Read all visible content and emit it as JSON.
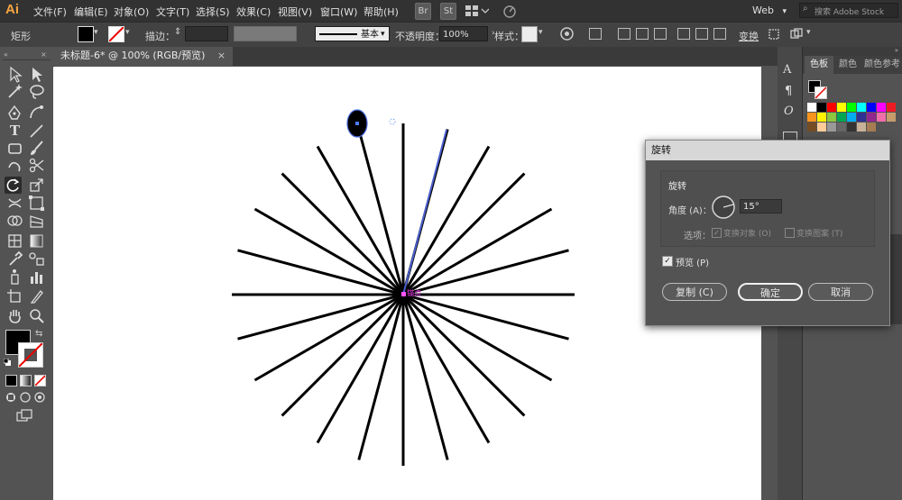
{
  "app": {
    "logo": "Ai"
  },
  "menubar": {
    "items": [
      "文件(F)",
      "编辑(E)",
      "对象(O)",
      "文字(T)",
      "选择(S)",
      "效果(C)",
      "视图(V)",
      "窗口(W)",
      "帮助(H)"
    ],
    "bridge": "Br",
    "stock": "St",
    "workspace": "Web",
    "search_placeholder": "搜索 Adobe Stock"
  },
  "control": {
    "object_label": "矩形",
    "stroke_label": "描边：",
    "stroke_style": "基本",
    "opacity_label": "不透明度：",
    "opacity_value": "100%",
    "style_label": "样式：",
    "transform_label": "变换"
  },
  "document": {
    "tab_title": "未标题-6* @ 100% (RGB/预览)",
    "anchor_label": "锚点"
  },
  "panels": {
    "tabs": [
      "色板",
      "颜色",
      "颜色参考"
    ]
  },
  "dialog": {
    "title": "旋转",
    "section": "旋转",
    "angle_label": "角度 (A)：",
    "angle_value": "15°",
    "options_label": "选项：",
    "transform_objects": "变换对象 (O)",
    "transform_patterns": "变换图案 (T)",
    "preview": "预览 (P)",
    "copy_button": "复制 (C)",
    "ok_button": "确定",
    "cancel_button": "取消"
  },
  "colors": {
    "accent": "#f7a440",
    "swatches": [
      "#ffffff",
      "#000000",
      "#ff0000",
      "#ffff00",
      "#00ff00",
      "#00ffff",
      "#0000ff",
      "#ff00ff",
      "#ed1c24",
      "#f7941d",
      "#fff200",
      "#8dc63f",
      "#00a651",
      "#00aeef",
      "#2e3192",
      "#92278f",
      "#f06eaa",
      "#c69c6d",
      "#754c24",
      "#ffcc99",
      "#999999",
      "#666666",
      "#333333",
      "#c7b299",
      "#a67c52"
    ]
  }
}
